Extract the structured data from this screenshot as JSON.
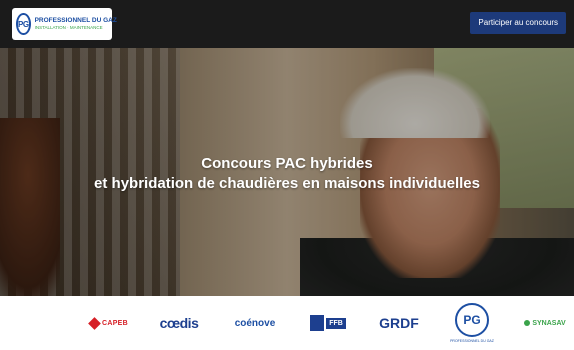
{
  "header": {
    "logo": {
      "monogram": "PG",
      "title": "PROFESSIONNEL DU GAZ",
      "subtitle": "INSTALLATION · MAINTENANCE"
    },
    "cta_label": "Participer au concours"
  },
  "hero": {
    "title_line1": "Concours PAC hybrides",
    "title_line2": "et hybridation de chaudières en maisons individuelles"
  },
  "partners": {
    "capeb": "CAPEB",
    "cedis": "cœdis",
    "coenove": "coénove",
    "ffb": "FFB",
    "grdf": "GRDF",
    "pg": "PG",
    "pg_sub": "PROFESSIONNEL DU GAZ",
    "synasav": "SYNASAV"
  },
  "colors": {
    "topbar": "#1b1b1b",
    "cta": "#1d3a7a",
    "brand_blue": "#1d4fa3",
    "brand_green": "#3aa34a",
    "capeb_red": "#d61f26"
  }
}
